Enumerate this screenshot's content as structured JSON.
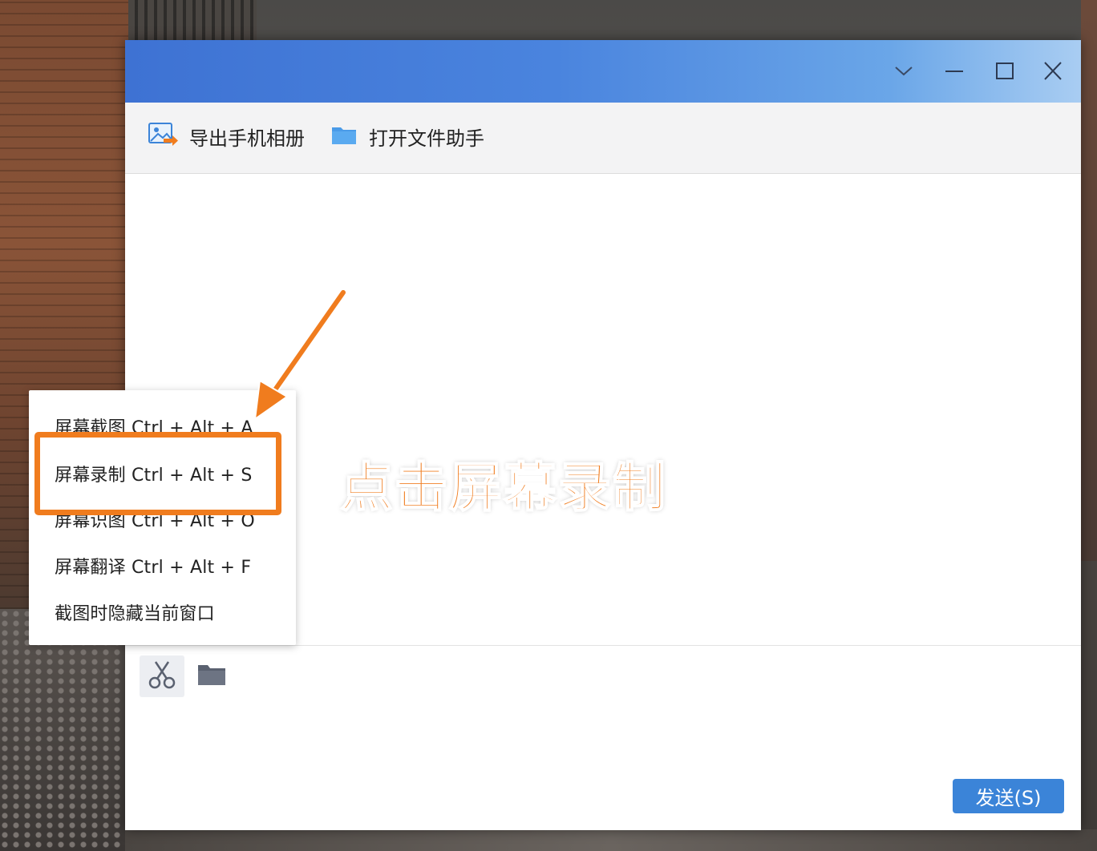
{
  "toolbar": {
    "export_album_label": "导出手机相册",
    "open_file_assistant_label": "打开文件助手"
  },
  "menu": {
    "items": [
      "屏幕截图 Ctrl + Alt + A",
      "屏幕录制 Ctrl + Alt + S",
      "屏幕识图 Ctrl + Alt + O",
      "屏幕翻译 Ctrl + Alt + F",
      "截图时隐藏当前窗口"
    ]
  },
  "annotation": {
    "callout_text": "点击屏幕录制"
  },
  "input": {
    "send_label": "发送(S)"
  },
  "icons": [
    "chevron-down-icon",
    "minimize-icon",
    "maximize-icon",
    "close-icon",
    "photo-export-icon",
    "folder-icon",
    "scissors-icon",
    "folder-icon"
  ],
  "colors": {
    "titlebar_start": "#3e72d3",
    "titlebar_end": "#a9cdf2",
    "highlight": "#f07c1e",
    "send_button": "#3b84d8"
  }
}
